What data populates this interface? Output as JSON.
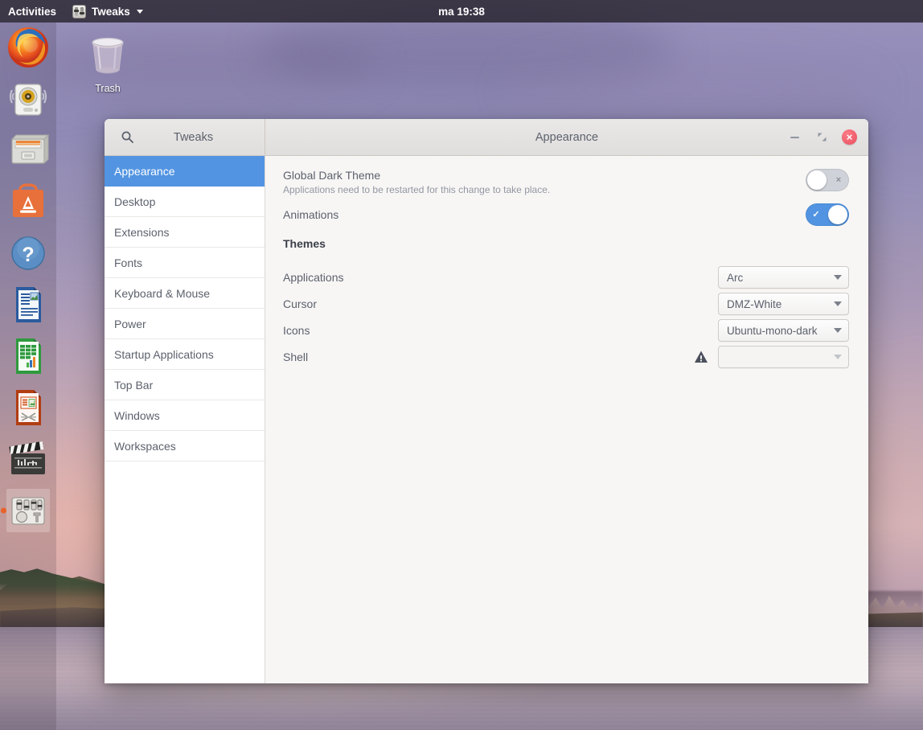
{
  "topbar": {
    "activities": "Activities",
    "app_menu_label": "Tweaks",
    "app_menu_icon": "tweaks-sliders-icon",
    "clock": "ma 19:38"
  },
  "desktop": {
    "trash": {
      "label": "Trash",
      "icon": "trash-bin-icon"
    }
  },
  "launcher": {
    "items": [
      {
        "name": "firefox",
        "tooltip": "Firefox"
      },
      {
        "name": "rhythmbox",
        "tooltip": "Rhythmbox"
      },
      {
        "name": "files",
        "tooltip": "Files"
      },
      {
        "name": "ubuntu-software",
        "tooltip": "Ubuntu Software"
      },
      {
        "name": "help",
        "tooltip": "Help"
      },
      {
        "name": "libreoffice-writer",
        "tooltip": "LibreOffice Writer"
      },
      {
        "name": "libreoffice-calc",
        "tooltip": "LibreOffice Calc"
      },
      {
        "name": "libreoffice-impress",
        "tooltip": "LibreOffice Impress"
      },
      {
        "name": "video-editor",
        "tooltip": "Video Editor"
      },
      {
        "name": "tweaks",
        "tooltip": "Tweaks"
      }
    ]
  },
  "window": {
    "sidebar_header_title": "Tweaks",
    "search_icon": "search-icon",
    "title": "Appearance",
    "controls": {
      "minimize": "minimize-icon",
      "maximize": "maximize-icon",
      "close": "×"
    },
    "sidebar": {
      "items": [
        {
          "label": "Appearance",
          "selected": true
        },
        {
          "label": "Desktop",
          "selected": false
        },
        {
          "label": "Extensions",
          "selected": false
        },
        {
          "label": "Fonts",
          "selected": false
        },
        {
          "label": "Keyboard & Mouse",
          "selected": false
        },
        {
          "label": "Power",
          "selected": false
        },
        {
          "label": "Startup Applications",
          "selected": false
        },
        {
          "label": "Top Bar",
          "selected": false
        },
        {
          "label": "Windows",
          "selected": false
        },
        {
          "label": "Workspaces",
          "selected": false
        }
      ]
    },
    "content": {
      "global_dark_theme": {
        "label": "Global Dark Theme",
        "description": "Applications need to be restarted for this change to take place.",
        "state": "off",
        "off_mark": "×"
      },
      "animations": {
        "label": "Animations",
        "state": "on",
        "on_mark": "✓"
      },
      "themes_section_title": "Themes",
      "themes": [
        {
          "label": "Applications",
          "value": "Arc",
          "warning": false,
          "disabled": false
        },
        {
          "label": "Cursor",
          "value": "DMZ-White",
          "warning": false,
          "disabled": false
        },
        {
          "label": "Icons",
          "value": "Ubuntu-mono-dark",
          "warning": false,
          "disabled": false
        },
        {
          "label": "Shell",
          "value": "",
          "warning": true,
          "disabled": true
        }
      ]
    }
  },
  "colors": {
    "accent_blue": "#5294e2",
    "close_red": "#f05c6b",
    "text": "#5c616c",
    "subtext": "#9397a1",
    "content_bg": "#f7f6f5",
    "titlebar_bg": "#e4e2e1"
  }
}
